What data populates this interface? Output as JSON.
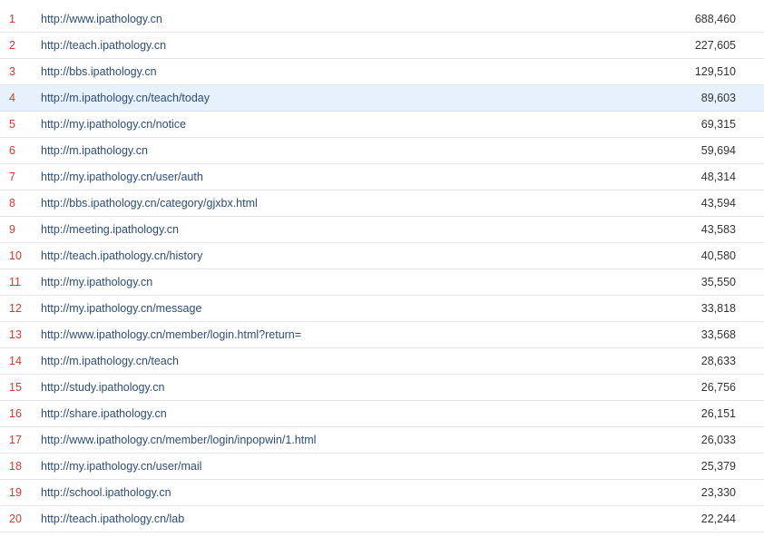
{
  "colors": {
    "rank": "#d33a2b",
    "link": "#2c4d78",
    "value": "#333333",
    "highlight_row": "#e6f1fb",
    "divider": "#e4e4e4"
  },
  "rows": [
    {
      "rank": "1",
      "url": "http://www.ipathology.cn",
      "count": "688,460"
    },
    {
      "rank": "2",
      "url": "http://teach.ipathology.cn",
      "count": "227,605"
    },
    {
      "rank": "3",
      "url": "http://bbs.ipathology.cn",
      "count": "129,510"
    },
    {
      "rank": "4",
      "url": "http://m.ipathology.cn/teach/today",
      "count": "89,603",
      "highlighted": true
    },
    {
      "rank": "5",
      "url": "http://my.ipathology.cn/notice",
      "count": "69,315"
    },
    {
      "rank": "6",
      "url": "http://m.ipathology.cn",
      "count": "59,694"
    },
    {
      "rank": "7",
      "url": "http://my.ipathology.cn/user/auth",
      "count": "48,314"
    },
    {
      "rank": "8",
      "url": "http://bbs.ipathology.cn/category/gjxbx.html",
      "count": "43,594"
    },
    {
      "rank": "9",
      "url": "http://meeting.ipathology.cn",
      "count": "43,583"
    },
    {
      "rank": "10",
      "url": "http://teach.ipathology.cn/history",
      "count": "40,580"
    },
    {
      "rank": "11",
      "url": "http://my.ipathology.cn",
      "count": "35,550"
    },
    {
      "rank": "12",
      "url": "http://my.ipathology.cn/message",
      "count": "33,818"
    },
    {
      "rank": "13",
      "url": "http://www.ipathology.cn/member/login.html?return=",
      "count": "33,568"
    },
    {
      "rank": "14",
      "url": "http://m.ipathology.cn/teach",
      "count": "28,633"
    },
    {
      "rank": "15",
      "url": "http://study.ipathology.cn",
      "count": "26,756"
    },
    {
      "rank": "16",
      "url": "http://share.ipathology.cn",
      "count": "26,151"
    },
    {
      "rank": "17",
      "url": "http://www.ipathology.cn/member/login/inpopwin/1.html",
      "count": "26,033"
    },
    {
      "rank": "18",
      "url": "http://my.ipathology.cn/user/mail",
      "count": "25,379"
    },
    {
      "rank": "19",
      "url": "http://school.ipathology.cn",
      "count": "23,330"
    },
    {
      "rank": "20",
      "url": "http://teach.ipathology.cn/lab",
      "count": "22,244"
    }
  ]
}
